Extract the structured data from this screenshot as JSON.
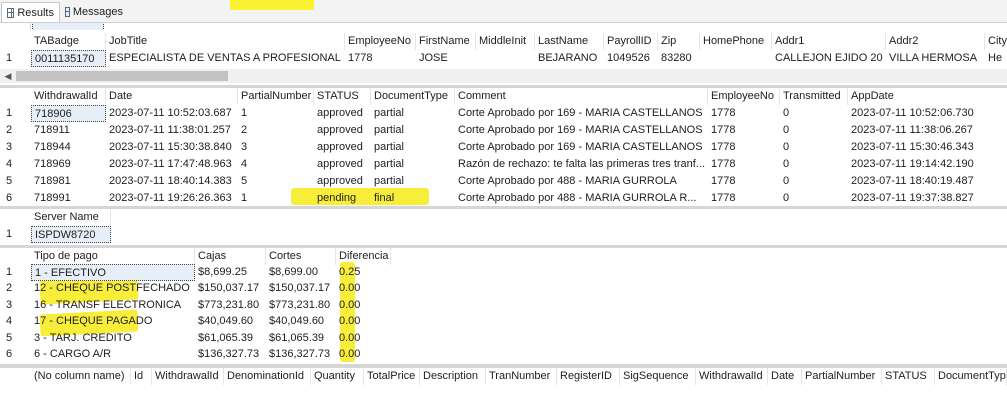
{
  "tabs": [
    {
      "label": "Results",
      "icon": "grid-icon"
    },
    {
      "label": "Messages",
      "icon": "messages-icon"
    }
  ],
  "grid1": {
    "columns": [
      "TABadge",
      "JobTitle",
      "EmployeeNo",
      "FirstName",
      "MiddleInit",
      "LastName",
      "PayrollID",
      "Zip",
      "HomePhone",
      "Addr1",
      "Addr2",
      "City"
    ],
    "rows": [
      {
        "n": "1",
        "cells": [
          "0011135170",
          "ESPECIALISTA DE VENTAS A PROFESIONAL",
          "1778",
          "JOSE",
          "",
          "BEJARANO",
          "1049526",
          "83280",
          "",
          "CALLEJON EJIDO 20",
          "VILLA HERMOSA",
          "He"
        ]
      }
    ]
  },
  "grid2": {
    "columns": [
      "WithdrawalId",
      "Date",
      "PartialNumber",
      "STATUS",
      "DocumentType",
      "Comment",
      "EmployeeNo",
      "Transmitted",
      "AppDate"
    ],
    "rows": [
      {
        "n": "1",
        "cells": [
          "718906",
          "2023-07-11 10:52:03.687",
          "1",
          "approved",
          "partial",
          "Corte Aprobado por 169 - MARIA CASTELLANOS",
          "1778",
          "0",
          "2023-07-11 10:52:06.730"
        ]
      },
      {
        "n": "2",
        "cells": [
          "718911",
          "2023-07-11 11:38:01.257",
          "2",
          "approved",
          "partial",
          "Corte Aprobado por 169 - MARIA CASTELLANOS",
          "1778",
          "0",
          "2023-07-11 11:38:06.267"
        ]
      },
      {
        "n": "3",
        "cells": [
          "718944",
          "2023-07-11 15:30:38.840",
          "3",
          "approved",
          "partial",
          "Corte Aprobado por 169 - MARIA CASTELLANOS",
          "1778",
          "0",
          "2023-07-11 15:30:46.343"
        ]
      },
      {
        "n": "4",
        "cells": [
          "718969",
          "2023-07-11 17:47:48.963",
          "4",
          "approved",
          "partial",
          "Razón de rechazo:  te falta las primeras tres tranf...",
          "1778",
          "0",
          "2023-07-11 19:14:42.190"
        ]
      },
      {
        "n": "5",
        "cells": [
          "718981",
          "2023-07-11 18:40:14.383",
          "5",
          "approved",
          "partial",
          "Corte Aprobado por 488 - MARIA GURROLA",
          "1778",
          "0",
          "2023-07-11 18:40:19.487"
        ]
      },
      {
        "n": "6",
        "cells": [
          "718991",
          "2023-07-11 19:26:26.363",
          "1",
          "pending",
          "final",
          "Corte Aprobado por 488 - MARIA GURROLA   R...",
          "1778",
          "0",
          "2023-07-11 19:37:38.827"
        ]
      }
    ]
  },
  "grid3": {
    "columns": [
      "Server Name"
    ],
    "rows": [
      {
        "n": "1",
        "cells": [
          "ISPDW8720"
        ]
      }
    ]
  },
  "grid4": {
    "columns": [
      "Tipo de pago",
      "Cajas",
      "Cortes",
      "Diferencia"
    ],
    "rows": [
      {
        "n": "1",
        "cells": [
          "1 - EFECTIVO",
          "$8,699.25",
          "$8,699.00",
          "0.25"
        ]
      },
      {
        "n": "2",
        "cells": [
          "12 - CHEQUE POSTFECHADO",
          "$150,037.17",
          "$150,037.17",
          "0.00"
        ]
      },
      {
        "n": "3",
        "cells": [
          "16 - TRANSF ELECTRONICA",
          "$773,231.80",
          "$773,231.80",
          "0.00"
        ]
      },
      {
        "n": "4",
        "cells": [
          "17 - CHEQUE PAGADO",
          "$40,049.60",
          "$40,049.60",
          "0.00"
        ]
      },
      {
        "n": "5",
        "cells": [
          "3 - TARJ. CREDITO",
          "$61,065.39",
          "$61,065.39",
          "0.00"
        ]
      },
      {
        "n": "6",
        "cells": [
          "6 - CARGO A/R",
          "$136,327.73",
          "$136,327.73",
          "0.00"
        ]
      }
    ]
  },
  "grid5": {
    "columns": [
      "(No column name)",
      "Id",
      "WithdrawalId",
      "DenominationId",
      "Quantity",
      "TotalPrice",
      "Description",
      "TranNumber",
      "RegisterID",
      "SigSequence",
      "WithdrawalId",
      "Date",
      "PartialNumber",
      "STATUS",
      "DocumentTyp"
    ]
  },
  "colors": {
    "highlight": "#fbf232",
    "focus": "#e6eef8",
    "separator": "#d6d6d6"
  }
}
